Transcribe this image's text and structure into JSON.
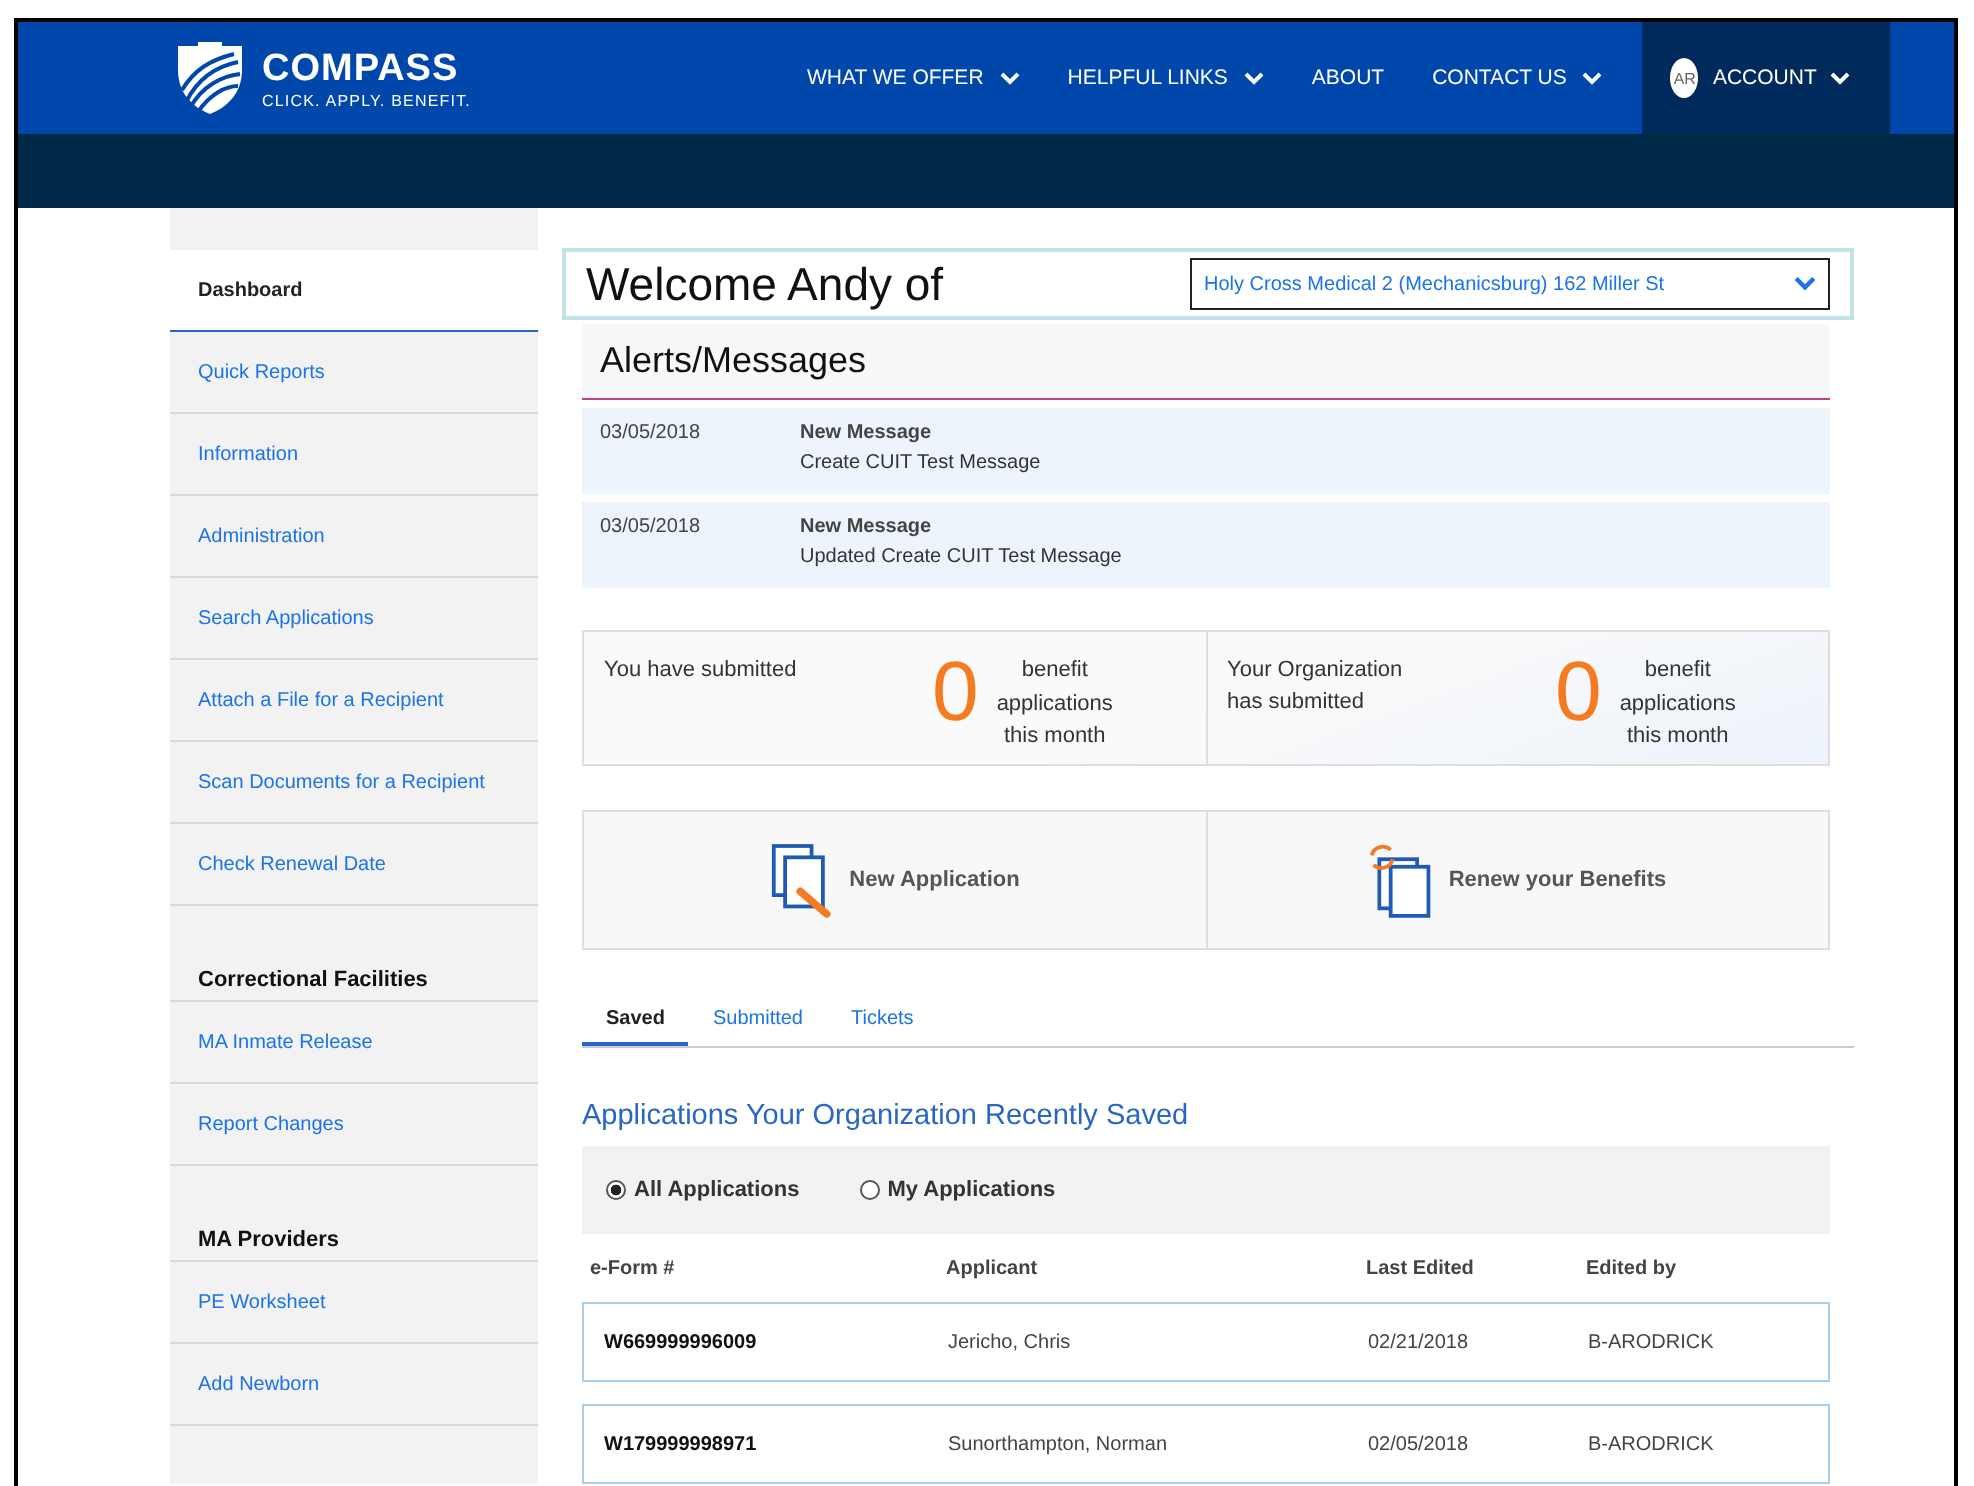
{
  "header": {
    "logo": {
      "name": "COMPASS",
      "tagline": "CLICK. APPLY. BENEFIT."
    },
    "nav": [
      {
        "label": "WHAT WE OFFER",
        "dropdown": true
      },
      {
        "label": "HELPFUL LINKS",
        "dropdown": true
      },
      {
        "label": "ABOUT",
        "dropdown": false
      },
      {
        "label": "CONTACT US",
        "dropdown": true
      }
    ],
    "account": {
      "initials": "AR",
      "label": "ACCOUNT"
    }
  },
  "sidebar": {
    "items": [
      {
        "kind": "link",
        "label": "Dashboard",
        "selected": true
      },
      {
        "kind": "link",
        "label": "Quick Reports",
        "selected": false
      },
      {
        "kind": "link",
        "label": "Information",
        "selected": false
      },
      {
        "kind": "link",
        "label": "Administration",
        "selected": false
      },
      {
        "kind": "link",
        "label": "Search Applications",
        "selected": false
      },
      {
        "kind": "link",
        "label": "Attach a File for a Recipient",
        "selected": false
      },
      {
        "kind": "link",
        "label": "Scan Documents for a Recipient",
        "selected": false
      },
      {
        "kind": "link",
        "label": "Check Renewal Date",
        "selected": false
      },
      {
        "kind": "heading",
        "label": "Correctional Facilities"
      },
      {
        "kind": "link",
        "label": "MA Inmate Release",
        "selected": false
      },
      {
        "kind": "link",
        "label": "Report Changes",
        "selected": false
      },
      {
        "kind": "heading",
        "label": "MA Providers"
      },
      {
        "kind": "link",
        "label": "PE Worksheet",
        "selected": false
      },
      {
        "kind": "link",
        "label": "Add Newborn",
        "selected": false
      }
    ]
  },
  "welcome": {
    "title": "Welcome Andy of",
    "organization": "Holy Cross Medical 2 (Mechanicsburg) 162 Miller St"
  },
  "alerts": {
    "title": "Alerts/Messages",
    "messages": [
      {
        "date": "03/05/2018",
        "subject": "New Message",
        "body": "Create CUIT Test Message"
      },
      {
        "date": "03/05/2018",
        "subject": "New Message",
        "body": "Updated Create CUIT Test Message"
      }
    ]
  },
  "stats": [
    {
      "label": "You have submitted",
      "count": "0",
      "unit": "benefit applications this month"
    },
    {
      "label": "Your Organization has submitted",
      "count": "0",
      "unit": "benefit applications this month"
    }
  ],
  "actions": [
    {
      "kind": "new",
      "label": "New Application"
    },
    {
      "kind": "renew",
      "label": "Renew your Benefits"
    }
  ],
  "tabs": [
    {
      "label": "Saved",
      "selected": true
    },
    {
      "label": "Submitted",
      "selected": false
    },
    {
      "label": "Tickets",
      "selected": false
    }
  ],
  "section_title": "Applications Your Organization Recently Saved",
  "filters": [
    {
      "label": "All Applications",
      "selected": true
    },
    {
      "label": "My Applications",
      "selected": false
    }
  ],
  "table": {
    "columns": [
      "e-Form #",
      "Applicant",
      "Last Edited",
      "Edited by"
    ],
    "rows": [
      [
        "W669999996009",
        "Jericho, Chris",
        "02/21/2018",
        "B-ARODRICK"
      ],
      [
        "W179999998971",
        "Sunorthampton, Norman",
        "02/05/2018",
        "B-ARODRICK"
      ]
    ]
  }
}
